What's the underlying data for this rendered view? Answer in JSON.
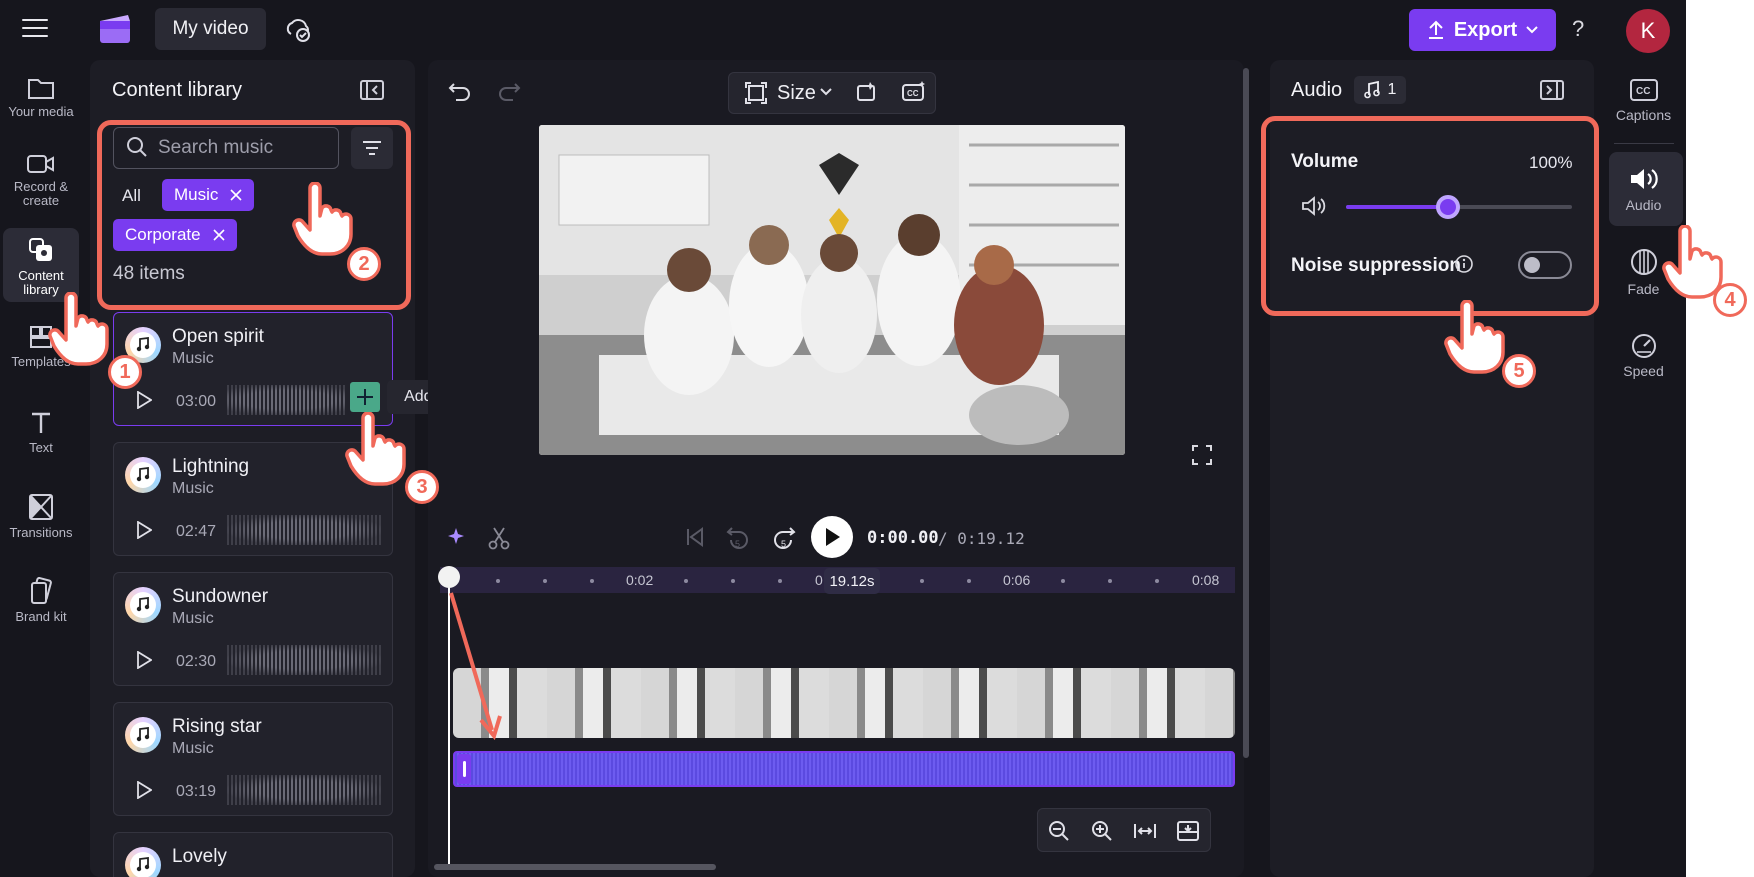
{
  "topbar": {
    "project_title": "My video",
    "export_label": "Export",
    "help_label": "?",
    "avatar_initial": "K"
  },
  "left_rail": [
    {
      "label": "Your media",
      "icon": "folder-icon"
    },
    {
      "label": "Record & create",
      "icon": "camera-icon"
    },
    {
      "label": "Content library",
      "icon": "content-library-icon",
      "active": true
    },
    {
      "label": "Templates",
      "icon": "templates-icon"
    },
    {
      "label": "Text",
      "icon": "text-icon"
    },
    {
      "label": "Transitions",
      "icon": "transitions-icon"
    },
    {
      "label": "Brand kit",
      "icon": "brand-kit-icon"
    }
  ],
  "library": {
    "title": "Content library",
    "search_placeholder": "Search music",
    "filter_all": "All",
    "chips": [
      "Music",
      "Corporate"
    ],
    "count": "48 items",
    "tracks": [
      {
        "name": "Open spirit",
        "genre": "Music",
        "duration": "03:00"
      },
      {
        "name": "Lightning",
        "genre": "Music",
        "duration": "02:47"
      },
      {
        "name": "Sundowner",
        "genre": "Music",
        "duration": "02:30"
      },
      {
        "name": "Rising star",
        "genre": "Music",
        "duration": "03:19"
      },
      {
        "name": "Lovely",
        "genre": "Music",
        "duration": ""
      }
    ],
    "tooltip": "Add to timeline"
  },
  "stage": {
    "size_label": "Size",
    "current_time": "0:00.00",
    "total_time": "/ 0:19.12",
    "ruler_labels": [
      "0:02",
      "0",
      "0:06",
      "0:08"
    ],
    "time_bubble": "19.12s",
    "skip_seconds": "5"
  },
  "audio_panel": {
    "title": "Audio",
    "badge_count": "1",
    "volume_label": "Volume",
    "volume_value": "100%",
    "volume_level": 0.45,
    "noise_label": "Noise suppression",
    "noise_on": false
  },
  "right_rail": [
    {
      "label": "Captions",
      "icon": "captions-icon"
    },
    {
      "label": "Audio",
      "icon": "speaker-icon",
      "active": true
    },
    {
      "label": "Fade",
      "icon": "fade-icon"
    },
    {
      "label": "Speed",
      "icon": "speedometer-icon"
    }
  ],
  "annotations": [
    "1",
    "2",
    "3",
    "4",
    "5"
  ],
  "colors": {
    "accent": "#7a3cf0",
    "highlight": "#f0695a",
    "background": "#16161d"
  }
}
